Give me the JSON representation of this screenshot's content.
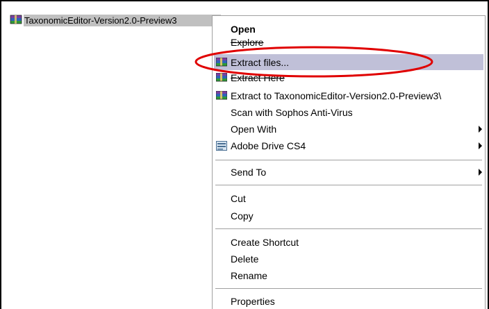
{
  "file": {
    "name": "TaxonomicEditor-Version2.0-Preview3",
    "icon": "winrar-archive-icon"
  },
  "menu": {
    "items": [
      {
        "label": "Open",
        "icon": "",
        "bold": true
      },
      {
        "label": "Explore",
        "icon": ""
      },
      {
        "label": "Extract files...",
        "icon": "winrar-icon",
        "highlighted": true
      },
      {
        "label": "Extract Here",
        "icon": "winrar-icon"
      },
      {
        "label": "Extract to TaxonomicEditor-Version2.0-Preview3\\",
        "icon": "winrar-icon"
      },
      {
        "label": "Scan with Sophos Anti-Virus",
        "icon": ""
      },
      {
        "label": "Open With",
        "icon": "",
        "submenu": true
      },
      {
        "label": "Adobe Drive CS4",
        "icon": "adobe-drive-icon",
        "submenu": true
      },
      {
        "label": "Send To",
        "icon": "",
        "submenu": true
      },
      {
        "label": "Cut",
        "icon": ""
      },
      {
        "label": "Copy",
        "icon": ""
      },
      {
        "label": "Create Shortcut",
        "icon": ""
      },
      {
        "label": "Delete",
        "icon": ""
      },
      {
        "label": "Rename",
        "icon": ""
      },
      {
        "label": "Properties",
        "icon": ""
      }
    ]
  },
  "annotation": {
    "color": "#e00000"
  }
}
